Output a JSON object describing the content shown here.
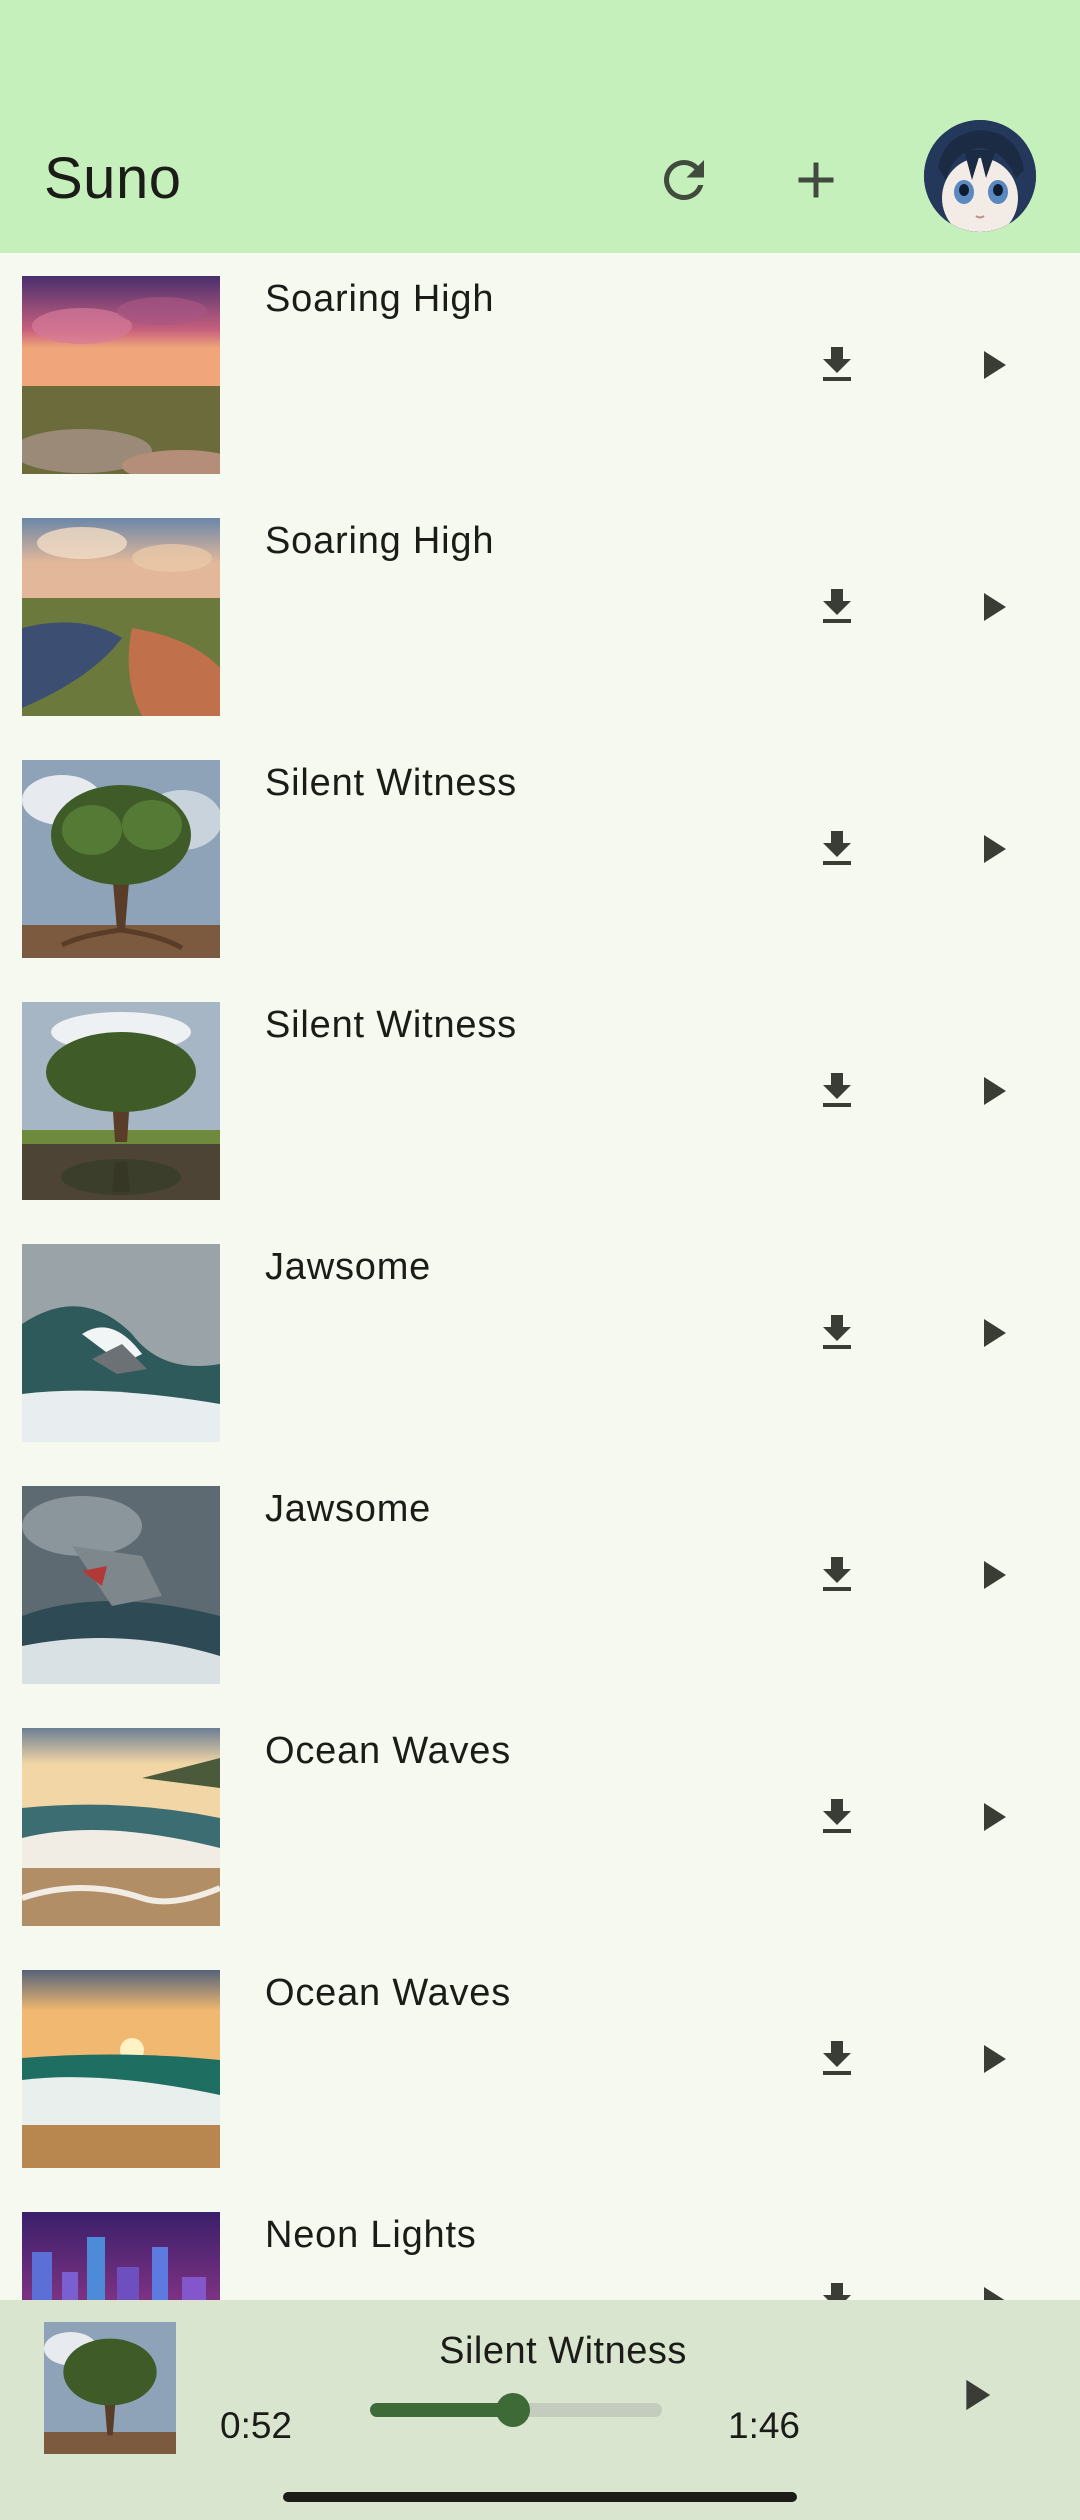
{
  "app": {
    "title": "Suno"
  },
  "toolbar": {
    "refresh_icon": "refresh-icon",
    "add_icon": "add-icon",
    "avatar": "user-avatar"
  },
  "songs": [
    {
      "title": "Soaring High",
      "art": "sunset-plateau"
    },
    {
      "title": "Soaring High",
      "art": "canyon-lake"
    },
    {
      "title": "Silent Witness",
      "art": "tree-roots"
    },
    {
      "title": "Silent Witness",
      "art": "tree-reflection"
    },
    {
      "title": "Jawsome",
      "art": "shark-wave"
    },
    {
      "title": "Jawsome",
      "art": "shark-jaws"
    },
    {
      "title": "Ocean Waves",
      "art": "beach-waves"
    },
    {
      "title": "Ocean Waves",
      "art": "beach-sunset"
    },
    {
      "title": "Neon Lights",
      "art": "neon-city"
    }
  ],
  "player": {
    "title": "Silent Witness",
    "current_time": "0:52",
    "total_time": "1:46",
    "progress": 0.49
  },
  "colors": {
    "top_bar": "#c6f0bb",
    "background": "#f6f9ef",
    "player_bg": "#dae5d0",
    "accent": "#3e6a37"
  }
}
